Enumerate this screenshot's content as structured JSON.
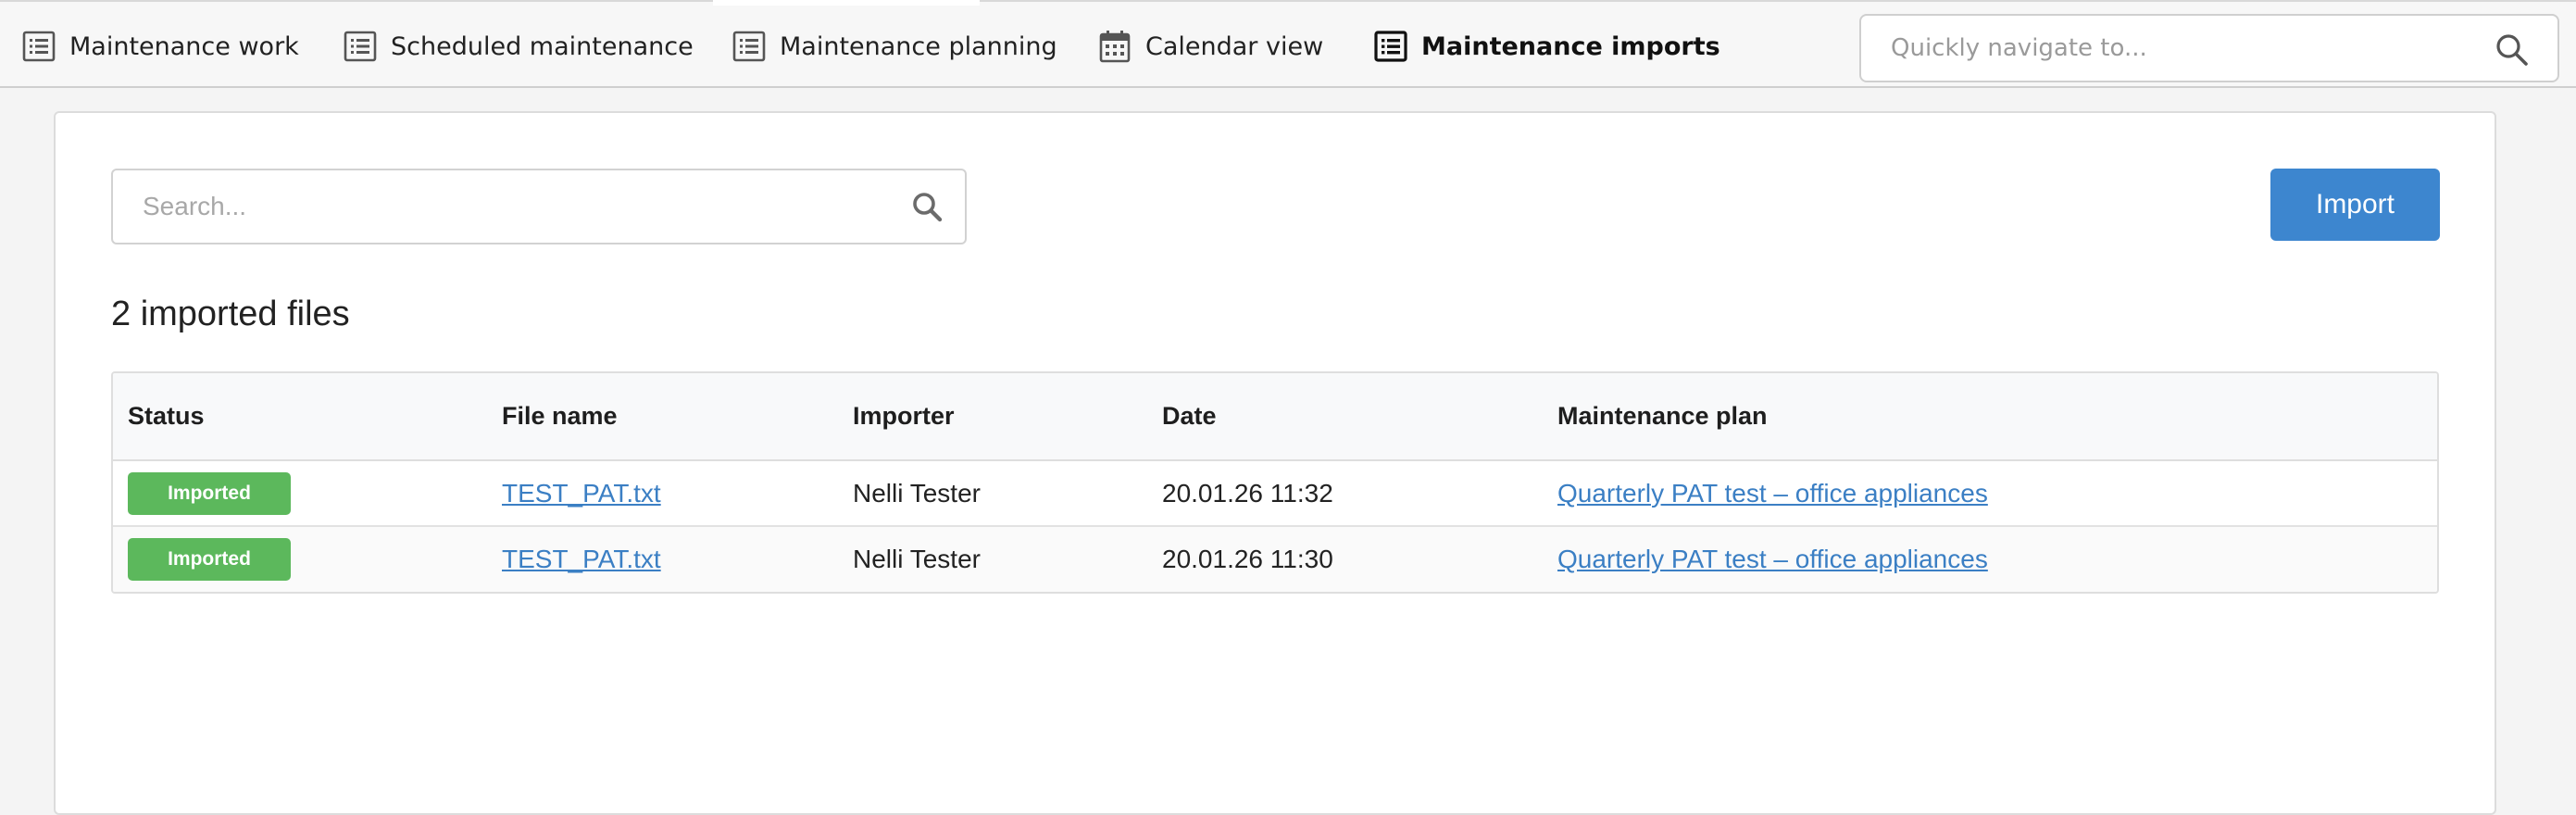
{
  "nav": {
    "tabs": [
      {
        "label": "Maintenance work",
        "icon": "list-icon",
        "active": false
      },
      {
        "label": "Scheduled maintenance",
        "icon": "list-icon",
        "active": false
      },
      {
        "label": "Maintenance planning",
        "icon": "list-icon",
        "active": false
      },
      {
        "label": "Calendar view",
        "icon": "calendar-icon",
        "active": false
      },
      {
        "label": "Maintenance imports",
        "icon": "list-icon",
        "active": true
      }
    ],
    "quick_nav": {
      "placeholder": "Quickly navigate to...",
      "icon": "search-icon"
    }
  },
  "search": {
    "placeholder": "Search...",
    "icon": "search-icon"
  },
  "import_button": {
    "label": "Import"
  },
  "files_count": "2 imported files",
  "colors": {
    "accent": "#3d86cf",
    "status_imported": "#5cb85c",
    "link": "#3b7fc4"
  },
  "table": {
    "columns": [
      "Status",
      "File name",
      "Importer",
      "Date",
      "Maintenance plan"
    ],
    "rows": [
      {
        "status": "Imported",
        "file_name": "TEST_PAT.txt",
        "importer": "Nelli Tester",
        "date": "20.01.26 11:32",
        "plan": "Quarterly PAT test – office appliances"
      },
      {
        "status": "Imported",
        "file_name": "TEST_PAT.txt",
        "importer": "Nelli Tester",
        "date": "20.01.26 11:30",
        "plan": "Quarterly PAT test – office appliances"
      }
    ]
  }
}
